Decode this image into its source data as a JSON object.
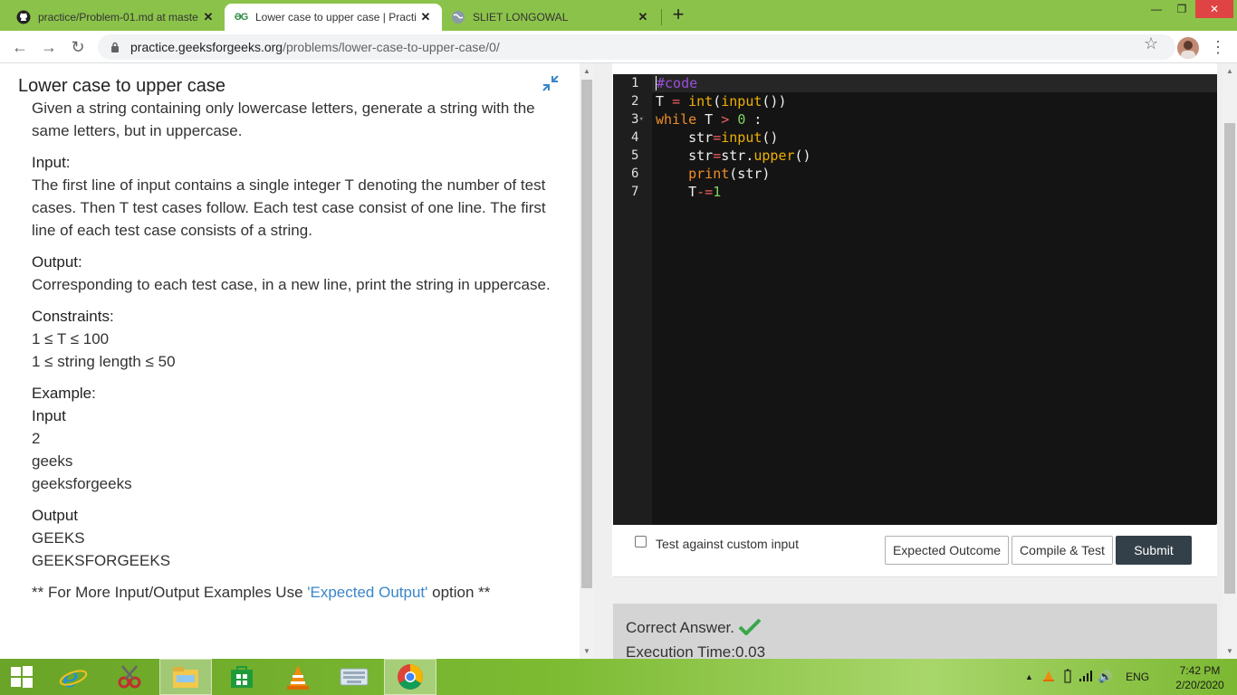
{
  "browser": {
    "tabs": [
      {
        "title": "practice/Problem-01.md at maste",
        "icon": "github-icon",
        "active": false
      },
      {
        "title": "Lower case to upper case | Practi",
        "icon": "gfg-icon",
        "active": true
      },
      {
        "title": "SLIET LONGOWAL",
        "icon": "globe-icon",
        "active": false
      }
    ],
    "new_tab": "+",
    "url_host": "practice.geeksforgeeks.org",
    "url_path": "/problems/lower-case-to-upper-case/0/"
  },
  "problem": {
    "title": "Lower case to upper case",
    "description": "Given a string containing only lowercase letters, generate a string with the same letters, but in uppercase.",
    "input_heading": "Input:",
    "input_text": "The first line of input contains a single integer T denoting the number of test cases. Then T test cases follow. Each test case consist of one line. The first line of each test case consists of a string.",
    "output_heading": "Output:",
    "output_text": "Corresponding to each test case, in a new line, print the string in uppercase.",
    "constraints_heading": "Constraints:",
    "constraints": [
      "1 ≤ T ≤ 100",
      "1 ≤ string length ≤ 50"
    ],
    "example_heading": "Example:",
    "example_input_heading": "Input",
    "example_input": [
      "2",
      "geeks",
      "geeksforgeeks"
    ],
    "example_output_heading": "Output",
    "example_output": [
      "GEEKS",
      "GEEKSFORGEEKS"
    ],
    "more_prefix": "** For More Input/Output Examples Use ",
    "more_link": "'Expected Output'",
    "more_suffix": " option **"
  },
  "editor": {
    "line_numbers": [
      "1",
      "2",
      "3",
      "4",
      "5",
      "6",
      "7"
    ],
    "fold_marker": "▾"
  },
  "actions": {
    "custom_input_label": "Test against custom input",
    "expected_outcome": "Expected Outcome",
    "compile_test": "Compile & Test",
    "submit": "Submit"
  },
  "result": {
    "status": "Correct Answer.",
    "execution_time": "Execution Time:0.03"
  },
  "taskbar": {
    "language": "ENG",
    "time": "7:42 PM",
    "date": "2/20/2020"
  },
  "colors": {
    "tabstrip": "#8bc34a",
    "editor_bg": "#141414",
    "submit_bg": "#334049",
    "link": "#3a86c8"
  }
}
